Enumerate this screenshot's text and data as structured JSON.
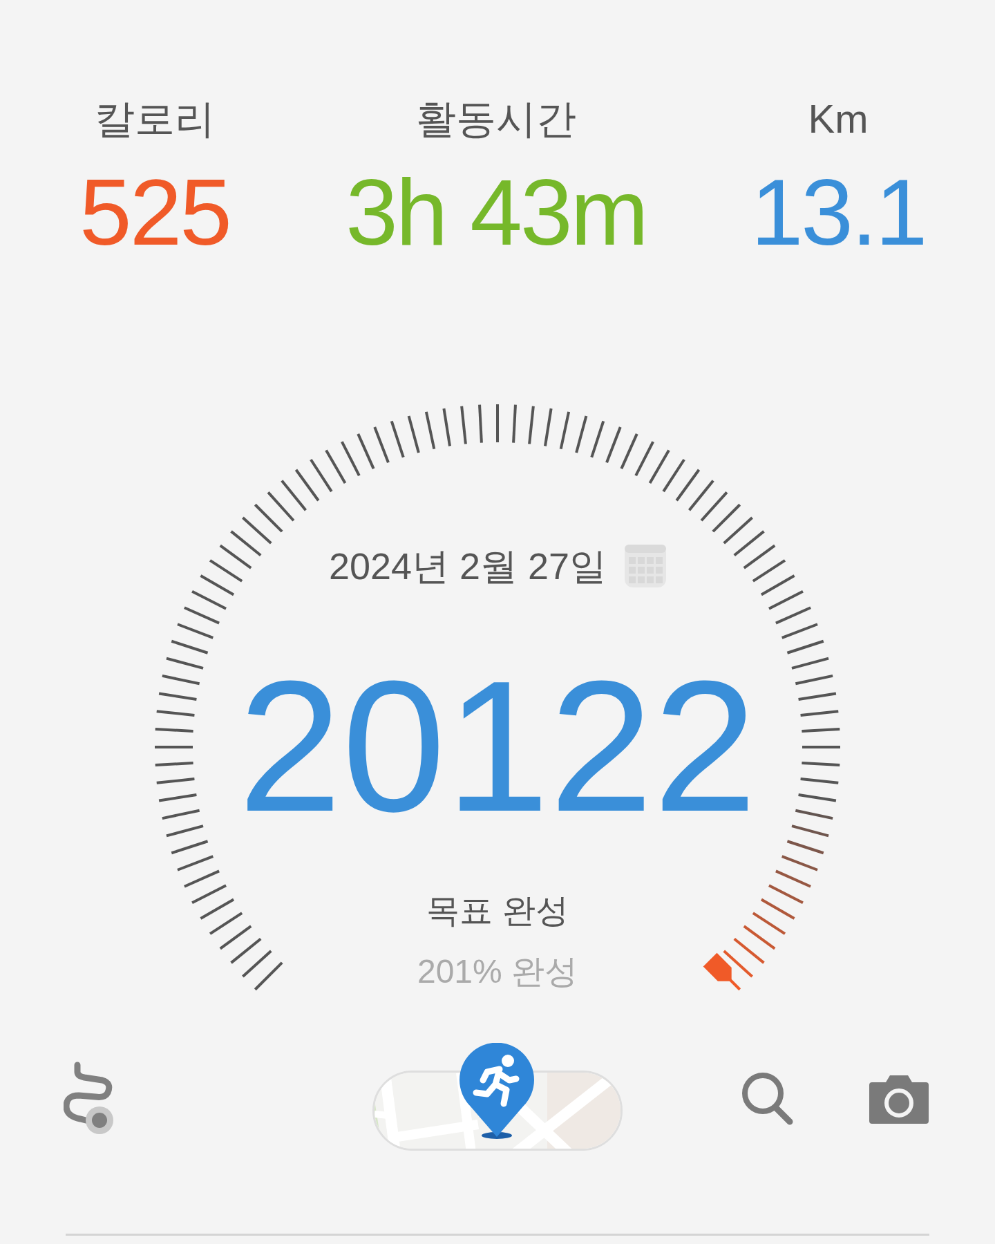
{
  "stats": [
    {
      "label": "칼로리",
      "value": "525",
      "color": "#f05a28"
    },
    {
      "label": "활동시간",
      "value": "3h 43m",
      "color": "#76b82a"
    },
    {
      "label": "Km",
      "value": "13.1",
      "color": "#3a8fd9"
    }
  ],
  "gauge": {
    "date": "2024년 2월 27일",
    "steps": "20122",
    "goal_status": "목표 완성",
    "percent": "201% 완성"
  }
}
